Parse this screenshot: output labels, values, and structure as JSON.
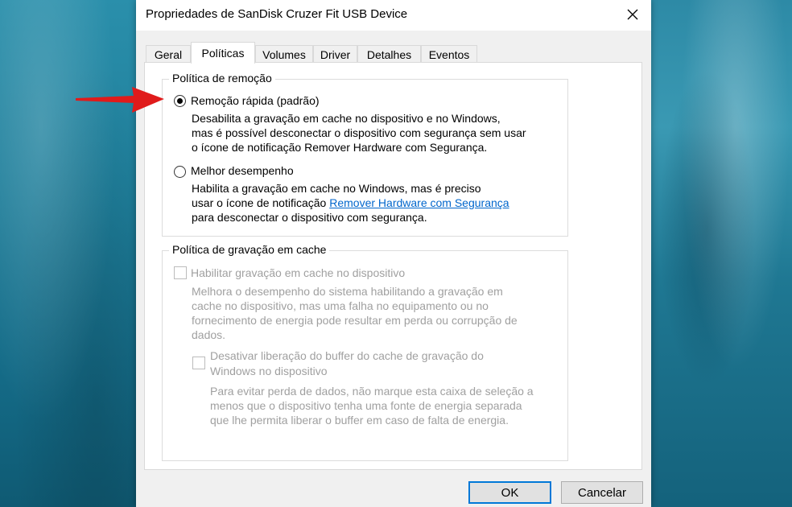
{
  "window": {
    "title": "Propriedades de SanDisk Cruzer Fit USB Device"
  },
  "tabs": [
    {
      "label": "Geral"
    },
    {
      "label": "Políticas"
    },
    {
      "label": "Volumes"
    },
    {
      "label": "Driver"
    },
    {
      "label": "Detalhes"
    },
    {
      "label": "Eventos"
    }
  ],
  "removal_policy": {
    "legend": "Política de remoção",
    "quick_removal": {
      "label": "Remoção rápida (padrão)",
      "selected": true,
      "desc_lines": [
        "Desabilita a gravação em cache no dispositivo e no Windows,",
        "mas é possível desconectar o dispositivo com segurança sem usar",
        "o ícone de notificação Remover Hardware com Segurança."
      ]
    },
    "better_performance": {
      "label": "Melhor desempenho",
      "selected": false,
      "desc_line1": "Habilita a gravação em cache no Windows, mas é preciso",
      "desc_line2_prefix": "usar o ícone de notificação ",
      "desc_link": "Remover Hardware com Segurança",
      "desc_line3": "para desconectar o dispositivo com segurança."
    }
  },
  "write_cache_policy": {
    "legend": "Política de gravação em cache",
    "enable_cache": {
      "label": "Habilitar gravação em cache no dispositivo",
      "checked": false,
      "desc_lines": [
        "Melhora o desempenho do sistema habilitando a gravação em",
        "cache no dispositivo, mas uma falha no equipamento ou no",
        "fornecimento de energia pode resultar em perda ou corrupção de",
        "dados."
      ]
    },
    "disable_flush": {
      "label_lines": [
        "Desativar liberação do buffer do cache de gravação do",
        "Windows no dispositivo"
      ],
      "checked": false,
      "desc_lines": [
        "Para evitar perda de dados, não marque esta caixa de seleção a",
        "menos que o dispositivo tenha uma fonte de energia separada",
        "que lhe permita liberar o buffer em caso de falta de energia."
      ]
    }
  },
  "buttons": {
    "ok": "OK",
    "cancel": "Cancelar"
  },
  "colors": {
    "arrow": "#e01b1b",
    "link": "#0066cc",
    "focus_border": "#0078d7",
    "disabled_text": "#a0a0a0"
  }
}
